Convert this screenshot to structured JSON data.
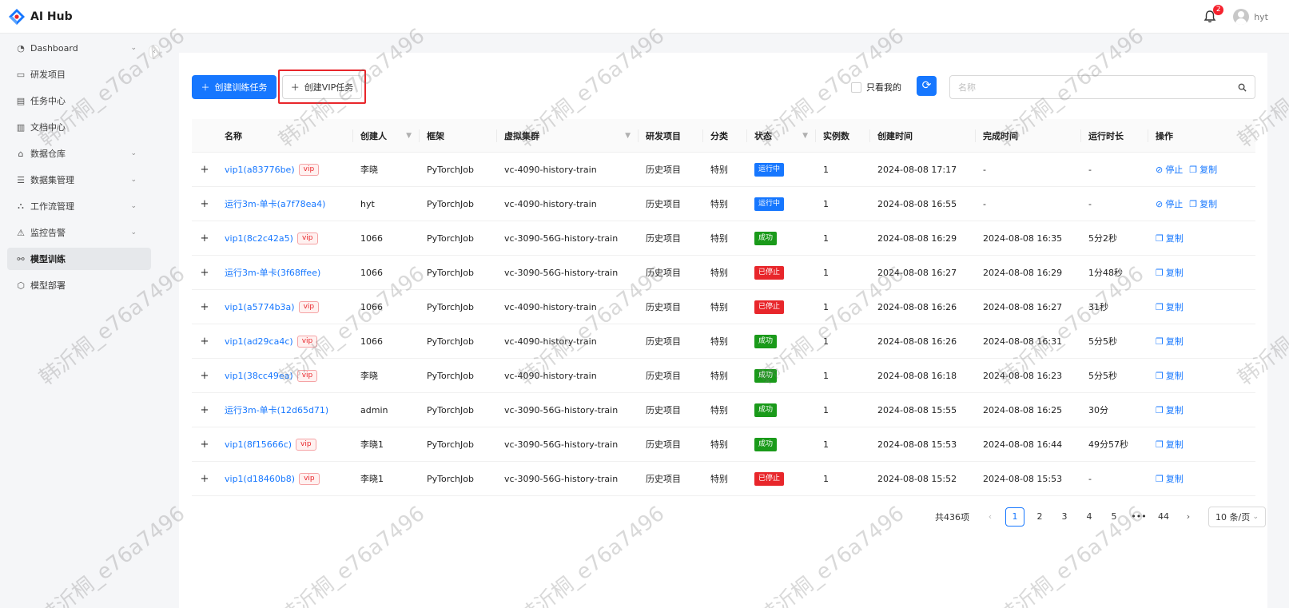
{
  "app": {
    "title": "AI Hub"
  },
  "header": {
    "notification_count": "2",
    "username": "hyt"
  },
  "sidebar": {
    "items": [
      {
        "label": "Dashboard",
        "icon": "gauge-icon",
        "has_children": true
      },
      {
        "label": "研发项目",
        "icon": "folder-icon",
        "has_children": false
      },
      {
        "label": "任务中心",
        "icon": "task-icon",
        "has_children": false
      },
      {
        "label": "文档中心",
        "icon": "document-icon",
        "has_children": false
      },
      {
        "label": "数据仓库",
        "icon": "warehouse-icon",
        "has_children": true
      },
      {
        "label": "数据集管理",
        "icon": "database-icon",
        "has_children": true
      },
      {
        "label": "工作流管理",
        "icon": "workflow-icon",
        "has_children": true
      },
      {
        "label": "监控告警",
        "icon": "alert-icon",
        "has_children": true
      },
      {
        "label": "模型训练",
        "icon": "model-train-icon",
        "has_children": false,
        "active": true
      },
      {
        "label": "模型部署",
        "icon": "deploy-icon",
        "has_children": false
      }
    ]
  },
  "toolbar": {
    "create_training_label": "创建训练任务",
    "create_vip_label": "创建VIP任务",
    "only_mine_label": "只看我的",
    "search_placeholder": "名称"
  },
  "table": {
    "columns": [
      "名称",
      "创建人",
      "框架",
      "虚拟集群",
      "研发项目",
      "分类",
      "状态",
      "实例数",
      "创建时间",
      "完成时间",
      "运行时长",
      "操作"
    ],
    "rows": [
      {
        "name": "vip1(a83776be)",
        "vip": true,
        "creator": "李晓",
        "framework": "PyTorchJob",
        "cluster": "vc-4090-history-train",
        "project": "历史项目",
        "category": "特别",
        "status": "运行中",
        "instances": "1",
        "created": "2024-08-08 17:17",
        "finished": "-",
        "duration": "-",
        "ops": [
          "停止",
          "复制"
        ]
      },
      {
        "name": "运行3m-单卡(a7f78ea4)",
        "vip": false,
        "creator": "hyt",
        "framework": "PyTorchJob",
        "cluster": "vc-4090-history-train",
        "project": "历史项目",
        "category": "特别",
        "status": "运行中",
        "instances": "1",
        "created": "2024-08-08 16:55",
        "finished": "-",
        "duration": "-",
        "ops": [
          "停止",
          "复制"
        ]
      },
      {
        "name": "vip1(8c2c42a5)",
        "vip": true,
        "creator": "1066",
        "framework": "PyTorchJob",
        "cluster": "vc-3090-56G-history-train",
        "project": "历史项目",
        "category": "特别",
        "status": "成功",
        "instances": "1",
        "created": "2024-08-08 16:29",
        "finished": "2024-08-08 16:35",
        "duration": "5分2秒",
        "ops": [
          "复制"
        ]
      },
      {
        "name": "运行3m-单卡(3f68ffee)",
        "vip": false,
        "creator": "1066",
        "framework": "PyTorchJob",
        "cluster": "vc-3090-56G-history-train",
        "project": "历史项目",
        "category": "特别",
        "status": "已停止",
        "instances": "1",
        "created": "2024-08-08 16:27",
        "finished": "2024-08-08 16:29",
        "duration": "1分48秒",
        "ops": [
          "复制"
        ]
      },
      {
        "name": "vip1(a5774b3a)",
        "vip": true,
        "creator": "1066",
        "framework": "PyTorchJob",
        "cluster": "vc-4090-history-train",
        "project": "历史项目",
        "category": "特别",
        "status": "已停止",
        "instances": "1",
        "created": "2024-08-08 16:26",
        "finished": "2024-08-08 16:27",
        "duration": "31秒",
        "ops": [
          "复制"
        ]
      },
      {
        "name": "vip1(ad29ca4c)",
        "vip": true,
        "creator": "1066",
        "framework": "PyTorchJob",
        "cluster": "vc-4090-history-train",
        "project": "历史项目",
        "category": "特别",
        "status": "成功",
        "instances": "1",
        "created": "2024-08-08 16:26",
        "finished": "2024-08-08 16:31",
        "duration": "5分5秒",
        "ops": [
          "复制"
        ]
      },
      {
        "name": "vip1(38cc49ea)",
        "vip": true,
        "creator": "李晓",
        "framework": "PyTorchJob",
        "cluster": "vc-4090-history-train",
        "project": "历史项目",
        "category": "特别",
        "status": "成功",
        "instances": "1",
        "created": "2024-08-08 16:18",
        "finished": "2024-08-08 16:23",
        "duration": "5分5秒",
        "ops": [
          "复制"
        ]
      },
      {
        "name": "运行3m-单卡(12d65d71)",
        "vip": false,
        "creator": "admin",
        "framework": "PyTorchJob",
        "cluster": "vc-3090-56G-history-train",
        "project": "历史项目",
        "category": "特别",
        "status": "成功",
        "instances": "1",
        "created": "2024-08-08 15:55",
        "finished": "2024-08-08 16:25",
        "duration": "30分",
        "ops": [
          "复制"
        ]
      },
      {
        "name": "vip1(8f15666c)",
        "vip": true,
        "creator": "李晓1",
        "framework": "PyTorchJob",
        "cluster": "vc-3090-56G-history-train",
        "project": "历史项目",
        "category": "特别",
        "status": "成功",
        "instances": "1",
        "created": "2024-08-08 15:53",
        "finished": "2024-08-08 16:44",
        "duration": "49分57秒",
        "ops": [
          "复制"
        ]
      },
      {
        "name": "vip1(d18460b8)",
        "vip": true,
        "creator": "李晓1",
        "framework": "PyTorchJob",
        "cluster": "vc-3090-56G-history-train",
        "project": "历史项目",
        "category": "特别",
        "status": "已停止",
        "instances": "1",
        "created": "2024-08-08 15:52",
        "finished": "2024-08-08 15:53",
        "duration": "-",
        "ops": [
          "复制"
        ]
      }
    ]
  },
  "status_colors": {
    "运行中": "#1677ff",
    "成功": "#1a9a1a",
    "已停止": "#e8262b"
  },
  "pagination": {
    "total_label": "共436项",
    "pages": [
      "1",
      "2",
      "3",
      "4",
      "5",
      "•••",
      "44"
    ],
    "current": "1",
    "page_size_label": "10 条/页"
  },
  "watermark": "韩沂桐_e76a7496",
  "colors": {
    "primary": "#1677ff",
    "danger": "#e8262b",
    "success": "#1a9a1a"
  }
}
